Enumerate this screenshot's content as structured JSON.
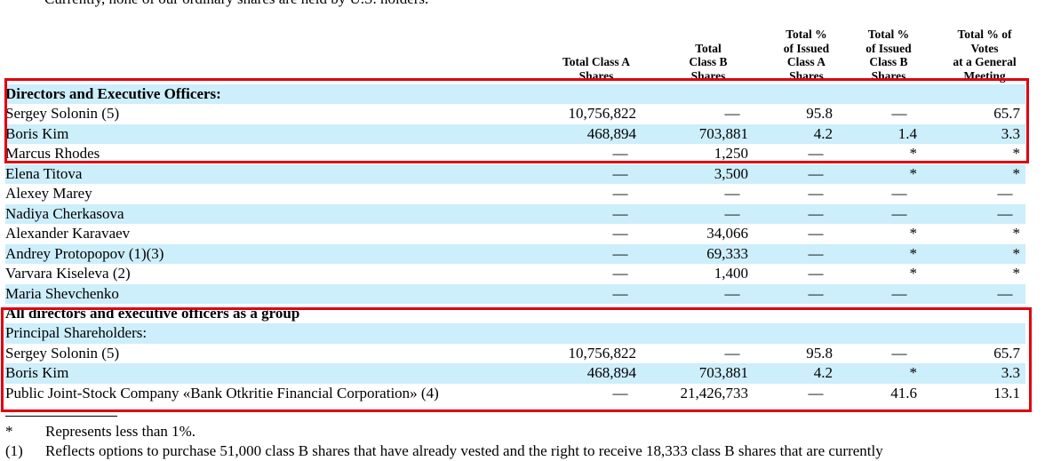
{
  "intro_text": "Currently, none of our ordinary shares are held by U.S. holders.",
  "columns": [
    {
      "lines": [
        "Total Class A",
        "Shares"
      ]
    },
    {
      "lines": [
        "Total",
        "Class B",
        "Shares"
      ]
    },
    {
      "lines": [
        "Total %",
        "of Issued",
        "Class A",
        "Shares"
      ]
    },
    {
      "lines": [
        "Total %",
        "of Issued",
        "Class B",
        "Shares"
      ]
    },
    {
      "lines": [
        "Total % of",
        "Votes",
        "at a General",
        "Meeting"
      ]
    }
  ],
  "rows": [
    {
      "label": "Directors and Executive Officers:",
      "bold": true,
      "shaded": true,
      "values": [
        "",
        "",
        "",
        "",
        ""
      ]
    },
    {
      "label": "Sergey Solonin (5)",
      "shaded": false,
      "values": [
        "10,756,822",
        "—",
        "95.8",
        "—",
        "65.7"
      ]
    },
    {
      "label": "Boris Kim",
      "shaded": true,
      "values": [
        "468,894",
        "703,881",
        "4.2",
        "1.4",
        "3.3"
      ]
    },
    {
      "label": "Marcus Rhodes",
      "shaded": false,
      "values": [
        "—",
        "1,250",
        "—",
        "*",
        "*"
      ]
    },
    {
      "label": "Elena Titova",
      "shaded": true,
      "values": [
        "—",
        "3,500",
        "—",
        "*",
        "*"
      ]
    },
    {
      "label": "Alexey Marey",
      "shaded": false,
      "values": [
        "—",
        "—",
        "—",
        "—",
        "—"
      ]
    },
    {
      "label": "Nadiya Cherkasova",
      "shaded": true,
      "values": [
        "—",
        "—",
        "—",
        "—",
        "—"
      ]
    },
    {
      "label": "Alexander Karavaev",
      "shaded": false,
      "values": [
        "—",
        "34,066",
        "—",
        "*",
        "*"
      ]
    },
    {
      "label": "Andrey Protopopov (1)(3)",
      "shaded": true,
      "values": [
        "—",
        "69,333",
        "—",
        "*",
        "*"
      ]
    },
    {
      "label": "Varvara Kiseleva (2)",
      "shaded": false,
      "values": [
        "—",
        "1,400",
        "—",
        "*",
        "*"
      ]
    },
    {
      "label": "Maria Shevchenko",
      "shaded": true,
      "values": [
        "—",
        "—",
        "—",
        "—",
        "—"
      ]
    },
    {
      "label": "All directors and executive officers as a group",
      "bold": true,
      "shaded": false,
      "values": [
        "",
        "",
        "",
        "",
        ""
      ]
    },
    {
      "label": "Principal Shareholders:",
      "shaded": true,
      "values": [
        "",
        "",
        "",
        "",
        ""
      ]
    },
    {
      "label": "Sergey Solonin (5)",
      "shaded": false,
      "values": [
        "10,756,822",
        "—",
        "95.8",
        "—",
        "65.7"
      ]
    },
    {
      "label": "Boris Kim",
      "shaded": true,
      "values": [
        "468,894",
        "703,881",
        "4.2",
        "*",
        "3.3"
      ]
    },
    {
      "label": "Public Joint-Stock Company «Bank Otkritie Financial Corporation» (4)",
      "shaded": false,
      "values": [
        "—",
        "21,426,733",
        "—",
        "41.6",
        "13.1"
      ]
    }
  ],
  "footnotes": [
    {
      "mark": "*",
      "text": "Represents less than 1%."
    },
    {
      "mark": "(1)",
      "text": "Reflects options to purchase 51,000 class B shares that have already vested and the right to receive 18,333 class B shares that are currently"
    }
  ],
  "highlight_color": "#e0000f",
  "row_shade_color": "#cdeefb"
}
